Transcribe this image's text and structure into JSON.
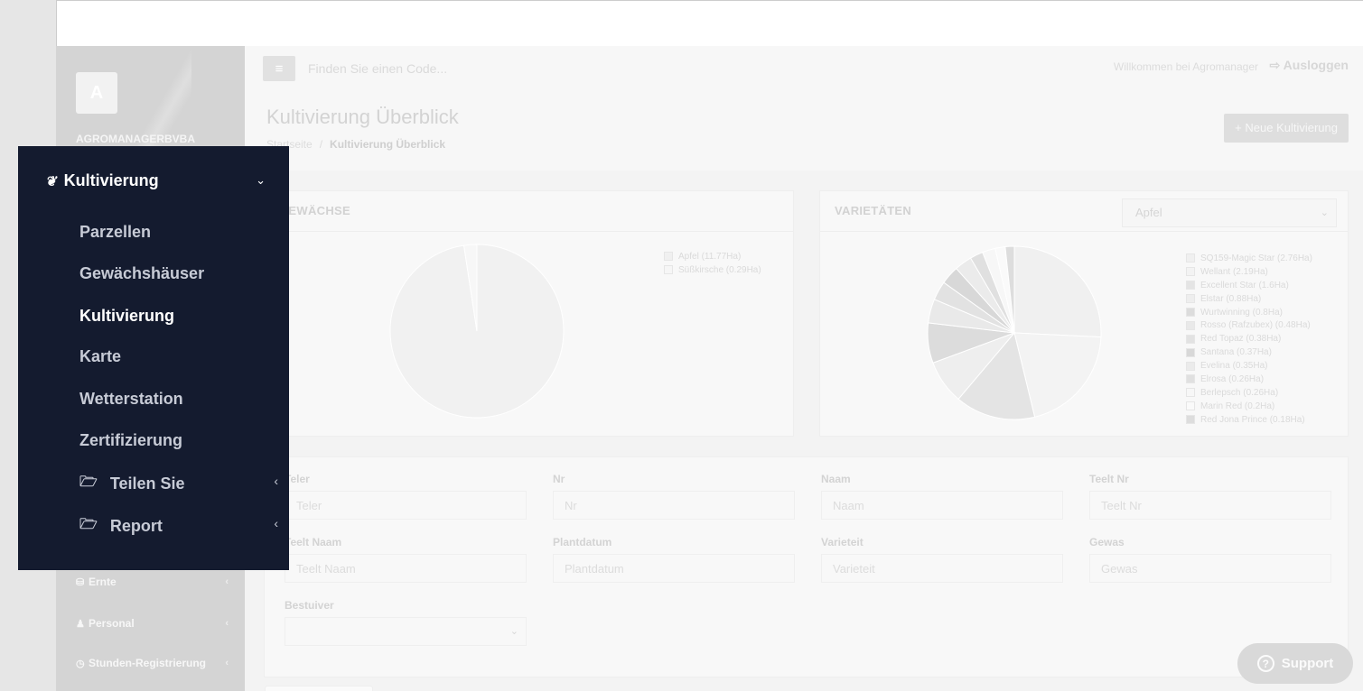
{
  "sidebar": {
    "avatar_letter": "A",
    "company": "AGROMANAGERBVBA",
    "items_below": [
      {
        "label": "Ernte",
        "icon": "basket-icon"
      },
      {
        "label": "Personal",
        "icon": "user-icon"
      },
      {
        "label": "Stunden-Registrierung",
        "icon": "clock-icon"
      }
    ]
  },
  "submenu": {
    "title": "Kultivierung",
    "items": [
      "Parzellen",
      "Gewächshäuser",
      "Kultivierung",
      "Karte",
      "Wetterstation",
      "Zertifizierung"
    ],
    "active_item": "Kultivierung",
    "folders": [
      "Teilen Sie",
      "Report"
    ]
  },
  "navbar": {
    "search_placeholder": "Finden Sie einen Code...",
    "welcome": "Willkommen bei Agromanager",
    "logout": "Ausloggen"
  },
  "page": {
    "title": "Kultivierung Überblick",
    "breadcrumb_home": "Startseite",
    "breadcrumb_sep": "/",
    "breadcrumb_current": "Kultivierung Überblick",
    "new_button": "+ Neue Kultivierung"
  },
  "crops_card": {
    "title": "GEWÄCHSE",
    "legend": [
      "Apfel (11.77Ha)",
      "Süßkirsche (0.29Ha)"
    ]
  },
  "varieties_card": {
    "title": "VARIETÄTEN",
    "select_value": "Apfel",
    "legend": [
      "SQ159-Magic Star (2.76Ha)",
      "Wellant (2.19Ha)",
      "Excellent Star (1.6Ha)",
      "Elstar (0.88Ha)",
      "Wurtwinning (0.8Ha)",
      "Rosso (Rafzubex) (0.48Ha)",
      "Red Topaz (0.38Ha)",
      "Santana (0.37Ha)",
      "Evelina (0.35Ha)",
      "Elrosa (0.26Ha)",
      "Berlepsch (0.26Ha)",
      "Marin Red (0.2Ha)",
      "Red Jona Prince (0.18Ha)"
    ]
  },
  "chart_data": [
    {
      "type": "pie",
      "categories": [
        "Apfel",
        "Süßkirsche"
      ],
      "values": [
        11.77,
        0.29
      ],
      "title": "GEWÄCHSE",
      "legend": "right"
    },
    {
      "type": "pie",
      "categories": [
        "SQ159-Magic Star",
        "Wellant",
        "Excellent Star",
        "Elstar",
        "Wurtwinning",
        "Rosso (Rafzubex)",
        "Red Topaz",
        "Santana",
        "Evelina",
        "Elrosa",
        "Berlepsch",
        "Marin Red",
        "Red Jona Prince"
      ],
      "values": [
        2.76,
        2.19,
        1.6,
        0.88,
        0.8,
        0.48,
        0.38,
        0.37,
        0.35,
        0.26,
        0.26,
        0.2,
        0.18
      ],
      "title": "VARIETÄTEN",
      "legend": "right"
    }
  ],
  "filters": {
    "fields": [
      {
        "label": "Teler",
        "placeholder": "Teler"
      },
      {
        "label": "Nr",
        "placeholder": "Nr"
      },
      {
        "label": "Naam",
        "placeholder": "Naam"
      },
      {
        "label": "Teelt Nr",
        "placeholder": "Teelt Nr"
      },
      {
        "label": "Teelt Naam",
        "placeholder": "Teelt Naam"
      },
      {
        "label": "Plantdatum",
        "placeholder": "Plantdatum"
      },
      {
        "label": "Varieteit",
        "placeholder": "Varieteit"
      },
      {
        "label": "Gewas",
        "placeholder": "Gewas"
      }
    ],
    "bestuiver_label": "Bestuiver"
  },
  "support_label": "Support",
  "colors": {
    "overlay_bg": "#141b2f",
    "overlay_text": "#c7cbd6",
    "active_text": "#ffffff"
  }
}
